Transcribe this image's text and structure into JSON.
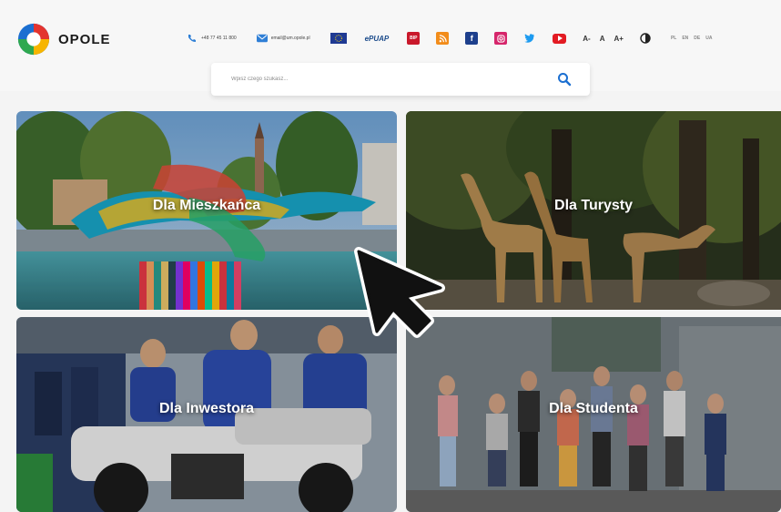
{
  "header": {
    "logo_text": "OPOLE",
    "phone": "+48 77 45 11 800",
    "email": "email@um.opole.pl",
    "bip_label": "BIP",
    "epuap_label": "ePUAP",
    "font_controls": [
      "A-",
      "A",
      "A+"
    ],
    "lang_codes": [
      "PL",
      "EN",
      "DE",
      "UA"
    ]
  },
  "search": {
    "placeholder": "Wpisz czego szukasz...",
    "icon": "search-icon"
  },
  "tiles": [
    {
      "label": "Dla Mieszkańca"
    },
    {
      "label": "Dla Turysty"
    },
    {
      "label": "Dla Inwestora"
    },
    {
      "label": "Dla Studenta"
    }
  ],
  "colors": {
    "accent_blue": "#1b6fd1",
    "facebook": "#1d3f8c",
    "instagram": "#d6266b",
    "twitter": "#1d9bf0",
    "youtube": "#e31b23",
    "rss": "#f28c1a"
  }
}
